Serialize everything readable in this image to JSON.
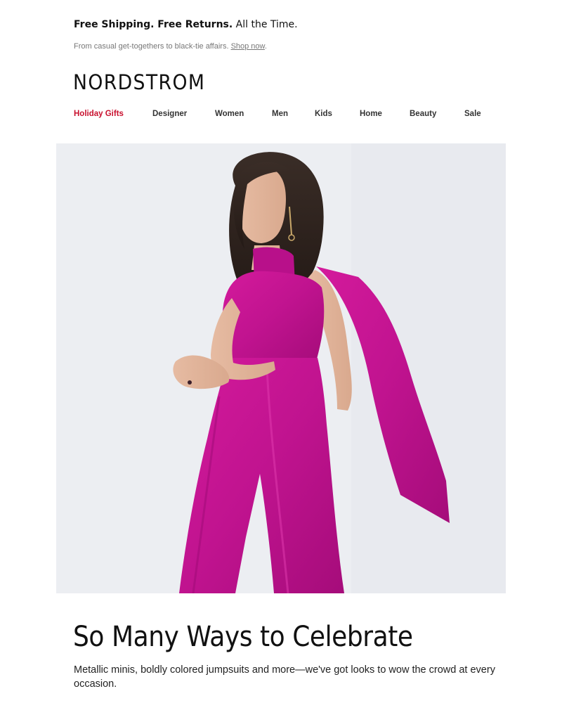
{
  "promo": {
    "bold": "Free Shipping. Free Returns.",
    "rest": " All the Time."
  },
  "subpromo": {
    "text": "From casual get-togethers to black-tie affairs. ",
    "link": "Shop now",
    "end": "."
  },
  "brand": {
    "logo": "NORDSTROM"
  },
  "nav": {
    "items": [
      {
        "label": "Holiday Gifts",
        "highlight": true
      },
      {
        "label": "Designer"
      },
      {
        "label": "Women"
      },
      {
        "label": "Men"
      },
      {
        "label": "Kids"
      },
      {
        "label": "Home"
      },
      {
        "label": "Beauty"
      },
      {
        "label": "Sale"
      }
    ],
    "highlight_color": "#c8102e"
  },
  "hero": {
    "image": "model-in-magenta-jumpsuit",
    "accent_color": "#c0138f"
  },
  "content": {
    "headline": "So Many Ways to Celebrate",
    "body": "Metallic minis, boldly colored jumpsuits and more—we've got looks to wow the crowd at every occasion."
  }
}
